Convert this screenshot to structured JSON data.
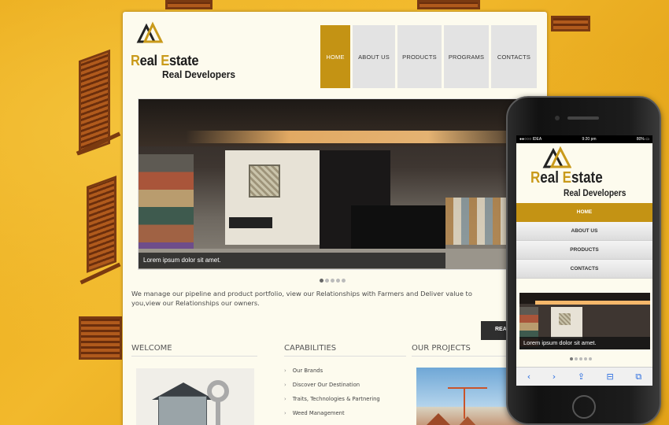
{
  "logo": {
    "title_cap1": "R",
    "title_rest1": "eal ",
    "title_cap2": "E",
    "title_rest2": "state",
    "subtitle": "Real Developers"
  },
  "nav": [
    {
      "label": "HOME",
      "active": true
    },
    {
      "label": "ABOUT US",
      "active": false
    },
    {
      "label": "PRODUCTS",
      "active": false
    },
    {
      "label": "PROGRAMS",
      "active": false
    },
    {
      "label": "CONTACTS",
      "active": false
    }
  ],
  "slider": {
    "caption": "Lorem ipsum dolor sit amet."
  },
  "intro": "We manage our pipeline and product portfolio, view our Relationships with Farmers and Deliver value to you,view our Relationships our owners.",
  "read_more": "READ MORE",
  "sections": {
    "welcome": "WELCOME",
    "capabilities": "CAPABILITIES",
    "projects": "OUR PROJECTS"
  },
  "capabilities": [
    "Our Brands",
    "Discover Our Destination",
    "Traits, Technologies & Partnering",
    "Weed Management"
  ],
  "phone": {
    "carrier": "●●○○○ IDEA",
    "time": "9:20 pm",
    "battery": "80% ▭",
    "nav": [
      "HOME",
      "ABOUT US",
      "PRODUCTS",
      "CONTACTS"
    ],
    "caption": "Lorem ipsum dolor sit amet.",
    "toolbar": {
      "back": "‹",
      "forward": "›",
      "share": "⇪",
      "bookmarks": "⊟",
      "tabs": "⧉"
    }
  },
  "colors": {
    "accent": "#c49314",
    "nav_bg": "#e3e3e3",
    "page_bg": "#fdfbee"
  }
}
